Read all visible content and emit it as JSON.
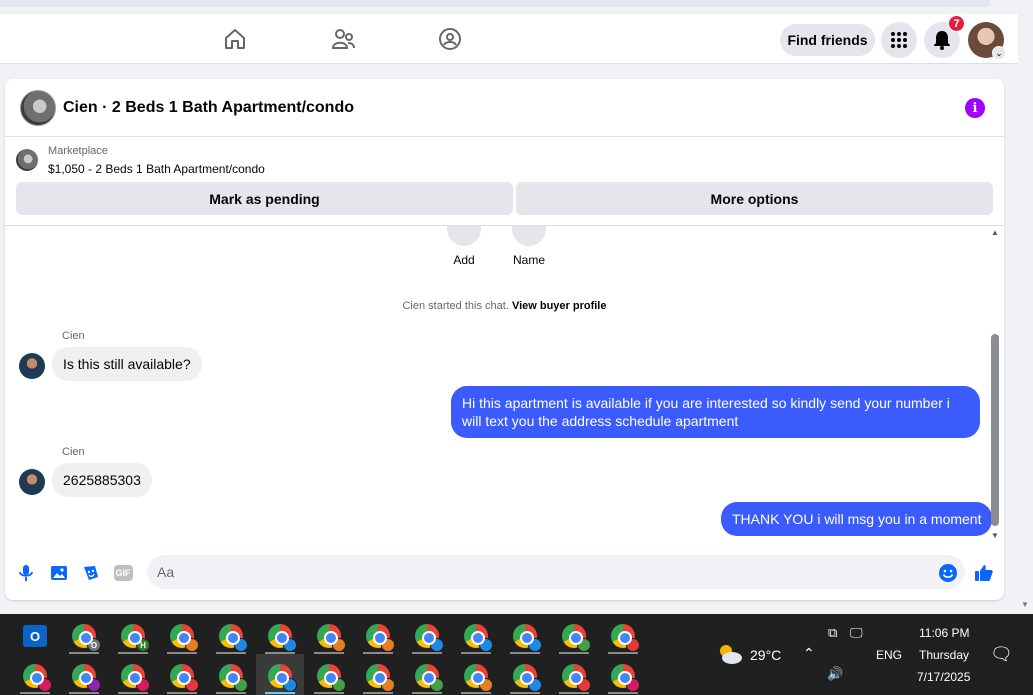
{
  "nav": {
    "find_friends_label": "Find friends",
    "notification_count": "7"
  },
  "chat": {
    "title": "Cien · 2 Beds 1 Bath Apartment/condo",
    "marketplace_label": "Marketplace",
    "listing": "$1,050 - 2 Beds 1 Bath Apartment/condo",
    "mark_pending_label": "Mark as pending",
    "more_options_label": "More options",
    "quick_actions": [
      "Add",
      "Name"
    ],
    "system_prefix": "Cien started this chat.",
    "system_link": "View buyer profile",
    "messages": [
      {
        "sender": "Cien",
        "text": "Is this still available?"
      },
      {
        "text": "Hi this apartment is available if you are interested so kindly send your number i will text you the address schedule apartment"
      },
      {
        "sender": "Cien",
        "text": "2625885303"
      },
      {
        "text": "THANK YOU i will msg you in a moment"
      }
    ],
    "composer_placeholder": "Aa",
    "gif_label": "GIF"
  },
  "taskbar": {
    "temperature": "29°C",
    "language": "ENG",
    "time": "11:06 PM",
    "day": "Thursday",
    "date": "7/17/2025",
    "outlook_letter": "O",
    "profile_badge_1": "O",
    "profile_badge_2": "H"
  },
  "colors": {
    "outgoing_bubble": "#3b5bfd",
    "incoming_bubble": "#f0f0f0",
    "info_icon": "#a200ff",
    "notification_badge": "#e41e3f",
    "taskbar": "#202020"
  }
}
